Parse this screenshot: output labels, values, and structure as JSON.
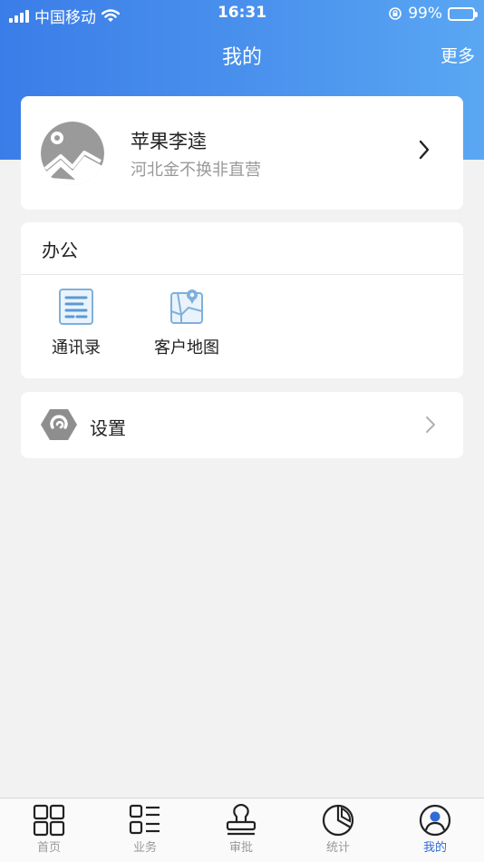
{
  "status_bar": {
    "carrier": "中国移动",
    "time": "16:31",
    "battery_text": "99%",
    "battery_level": 0.99
  },
  "nav": {
    "title": "我的",
    "more_label": "更多"
  },
  "profile": {
    "name": "苹果李逵",
    "organization": "河北金不换非直营",
    "avatar_icon": "image-placeholder-icon"
  },
  "office": {
    "title": "办公",
    "items": [
      {
        "label": "通讯录",
        "icon": "contacts-list-icon"
      },
      {
        "label": "客户地图",
        "icon": "map-pin-icon"
      }
    ]
  },
  "settings": {
    "label": "设置",
    "icon": "settings-hexagon-icon"
  },
  "tabbar": {
    "active_index": 4,
    "accent_color": "#2f6bd8",
    "items": [
      {
        "label": "首页",
        "icon": "grid-four-icon"
      },
      {
        "label": "业务",
        "icon": "list-grid-icon"
      },
      {
        "label": "审批",
        "icon": "stamp-icon"
      },
      {
        "label": "统计",
        "icon": "pie-chart-icon"
      },
      {
        "label": "我的",
        "icon": "user-circle-icon"
      }
    ]
  },
  "colors": {
    "header_gradient_start": "#3b7de8",
    "header_gradient_end": "#5aa7f3",
    "background": "#f2f2f2"
  }
}
